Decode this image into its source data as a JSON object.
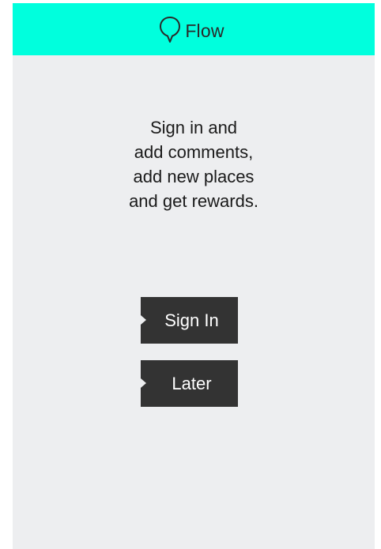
{
  "app_bar": {
    "title": "Flow",
    "icon": "map-pin-icon",
    "background_color": "#00ffdd"
  },
  "message": {
    "lines": [
      "Sign in and",
      "add comments,",
      "add new places",
      "and get rewards."
    ]
  },
  "buttons": {
    "sign_in_label": "Sign In",
    "later_label": "Later",
    "background_color": "#333333"
  },
  "screen": {
    "background_color": "#edeef0"
  }
}
